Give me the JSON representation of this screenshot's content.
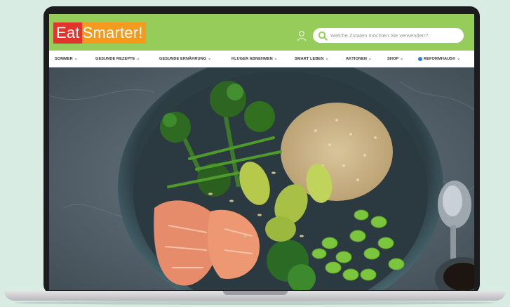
{
  "logo": {
    "part1": "Eat",
    "part2": "Smarter!"
  },
  "search": {
    "placeholder": "Welche Zutaten möchten Sie verwenden?"
  },
  "nav": {
    "items": [
      {
        "label": "SOMMER"
      },
      {
        "label": "GESUNDE REZEPTE"
      },
      {
        "label": "GESUNDE ERNÄHRUNG"
      },
      {
        "label": "KLUGER ABNEHMEN"
      },
      {
        "label": "SMART LEBEN"
      },
      {
        "label": "AKTIONEN"
      },
      {
        "label": "SHOP"
      },
      {
        "label": "REFORMHAUS®"
      }
    ]
  },
  "icons": {
    "user": "user-icon",
    "search": "search-icon",
    "chevron": "chevron-down-icon"
  },
  "colors": {
    "background": "#d8ece4",
    "header_green": "#96cc5a",
    "logo_red": "#e2342b",
    "logo_orange": "#f39a1f"
  }
}
